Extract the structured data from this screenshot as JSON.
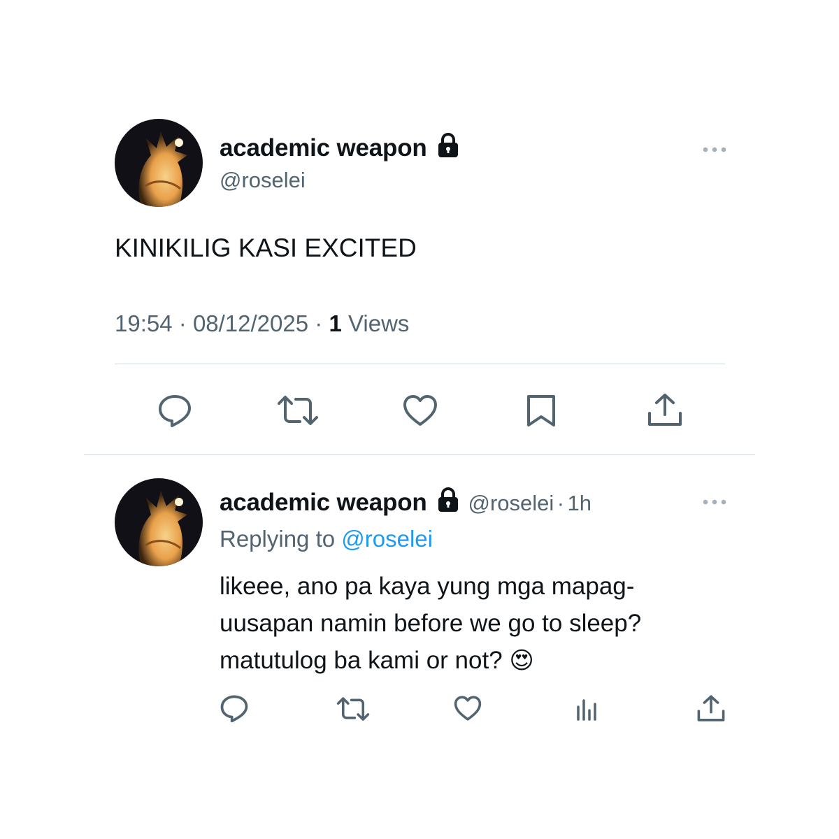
{
  "main_tweet": {
    "author_name": "academic weapon",
    "handle": "@roselei",
    "text": "KINIKILIG KASI EXCITED",
    "time": "19:54",
    "separator": "·",
    "date": "08/12/2025",
    "views_count": "1",
    "views_label": "Views",
    "actions": [
      "reply-icon",
      "retweet-icon",
      "like-icon",
      "bookmark-icon",
      "share-icon"
    ]
  },
  "reply_tweet": {
    "author_name": "academic weapon",
    "handle": "@roselei",
    "separator": "·",
    "age": "1h",
    "replying_to_label": "Replying to",
    "replying_to_handle": "@roselei",
    "text": "likeee, ano pa kaya yung mga mapag-uusapan namin before we go to sleep? matutulog ba kami or not?",
    "emoji": "😍",
    "actions": [
      "reply-icon",
      "retweet-icon",
      "like-icon",
      "analytics-icon",
      "share-icon"
    ]
  },
  "colors": {
    "text": "#0f1419",
    "secondary": "#536471",
    "link": "#1d9bf0",
    "divider": "#cfd9de"
  }
}
